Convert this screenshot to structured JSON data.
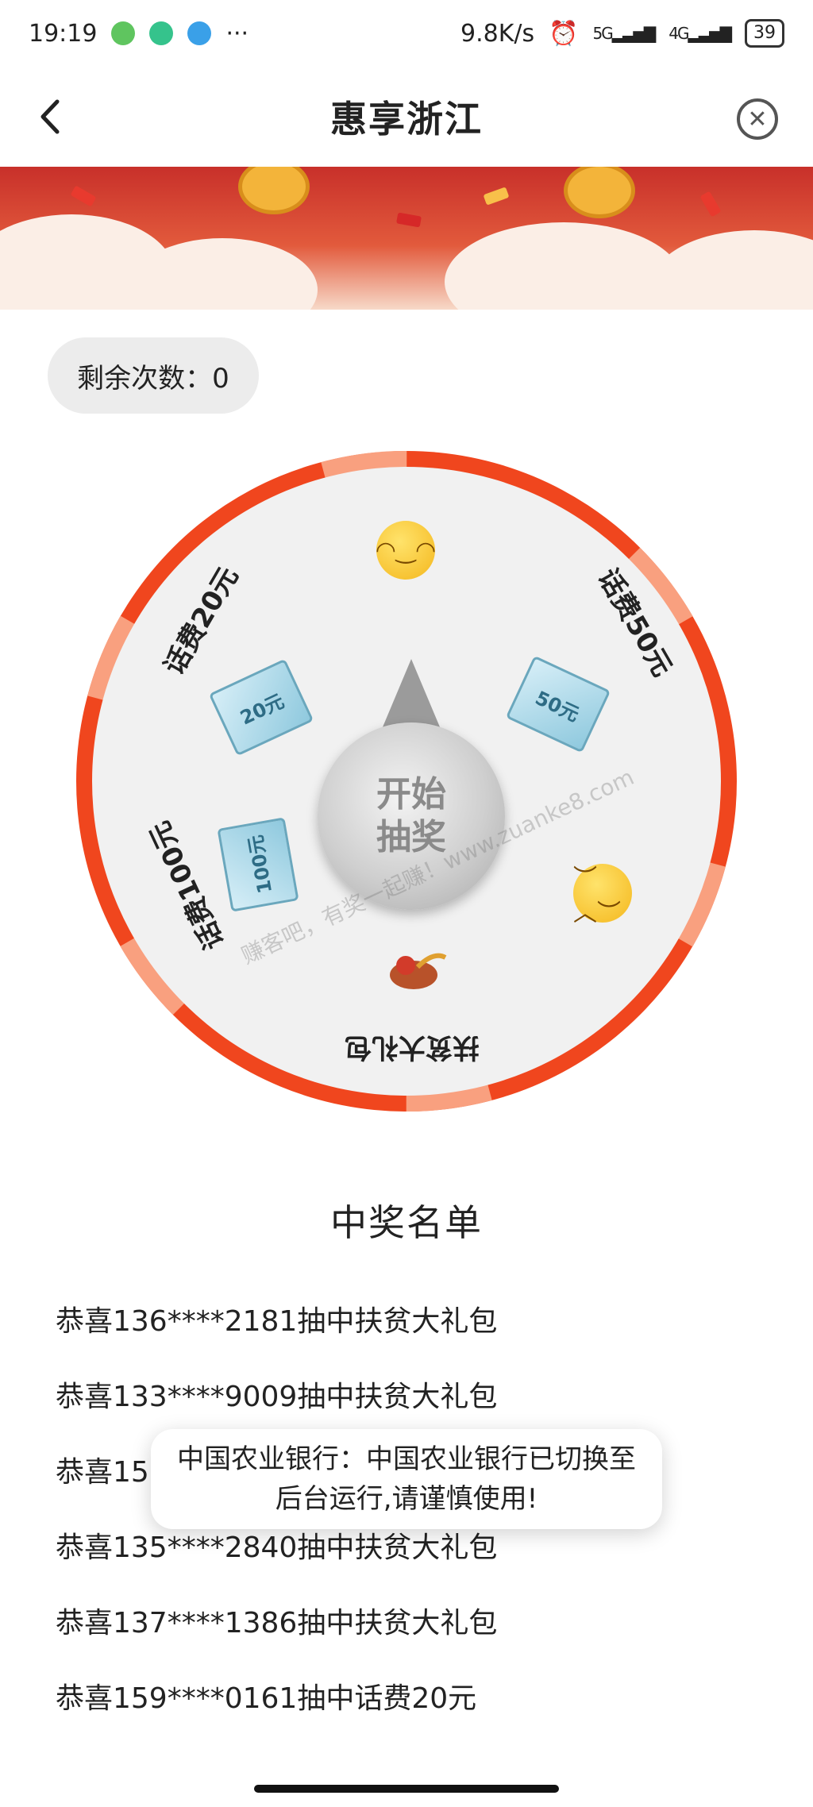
{
  "status_bar": {
    "time": "19:19",
    "net_speed": "9.8K/s",
    "signal_1": "5G",
    "signal_2": "4G",
    "battery": "39"
  },
  "header": {
    "title": "惠享浙江"
  },
  "lottery": {
    "remaining_label": "剩余次数：0",
    "start_button_line1": "开始",
    "start_button_line2": "抽奖",
    "prizes": [
      {
        "label": "话费20元",
        "ticket": "20元"
      },
      {
        "label": "话费50元",
        "ticket": "50元"
      },
      {
        "label": "话费100元",
        "ticket": "100元"
      },
      {
        "label": "扶贫大礼包"
      }
    ],
    "watermark": "赚客吧，有奖一起赚！www.zuanke8.com"
  },
  "winners": {
    "title": "中奖名单",
    "items": [
      "恭喜136****2181抽中扶贫大礼包",
      "恭喜133****9009抽中扶贫大礼包",
      "恭喜15",
      "恭喜135****2840抽中扶贫大礼包",
      "恭喜137****1386抽中扶贫大礼包",
      "恭喜159****0161抽中话费20元"
    ]
  },
  "toast": {
    "text": "中国农业银行：中国农业银行已切换至后台运行,请谨慎使用!"
  },
  "colors": {
    "wheel_ring_dark": "#f0461e",
    "wheel_ring_light": "#f9a07f",
    "wheel_face": "#f1f1f1"
  }
}
